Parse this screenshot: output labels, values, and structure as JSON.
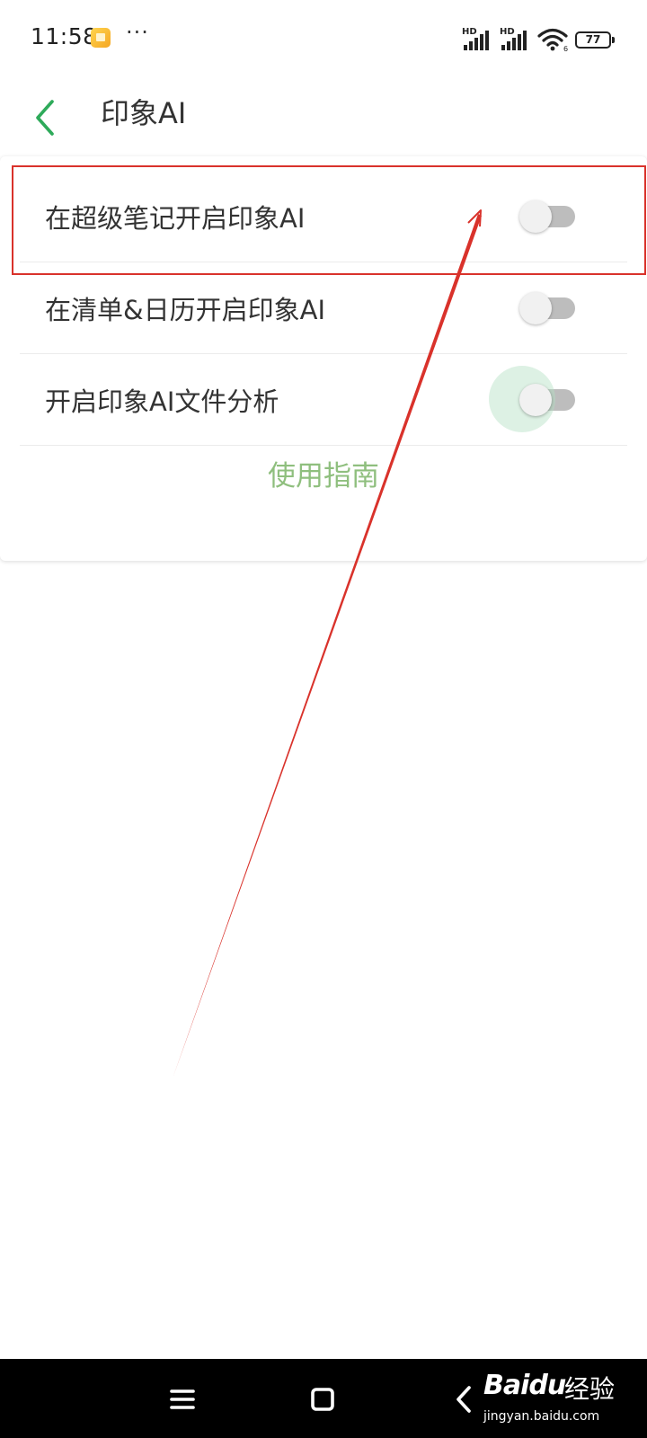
{
  "status_bar": {
    "time": "11:58",
    "dots": "···",
    "hd1": "HD",
    "hd2": "HD",
    "battery": "77"
  },
  "header": {
    "title": "印象AI"
  },
  "settings": {
    "items": [
      {
        "label": "在超级笔记开启印象AI",
        "enabled": false
      },
      {
        "label": "在清单&日历开启印象AI",
        "enabled": false
      },
      {
        "label": "开启印象AI文件分析",
        "enabled": false
      }
    ],
    "guide_link": "使用指南"
  },
  "colors": {
    "accent": "#2eaa5a",
    "guide_link": "#8fbf7e",
    "annotation": "#d9322b",
    "toggle_off_track": "#bdbdbd",
    "toggle_knob": "#f1f1f1"
  },
  "watermark": {
    "logo": "Bai",
    "logo_suffix": "du",
    "jingyan": "经验",
    "url": "jingyan.baidu.com"
  }
}
